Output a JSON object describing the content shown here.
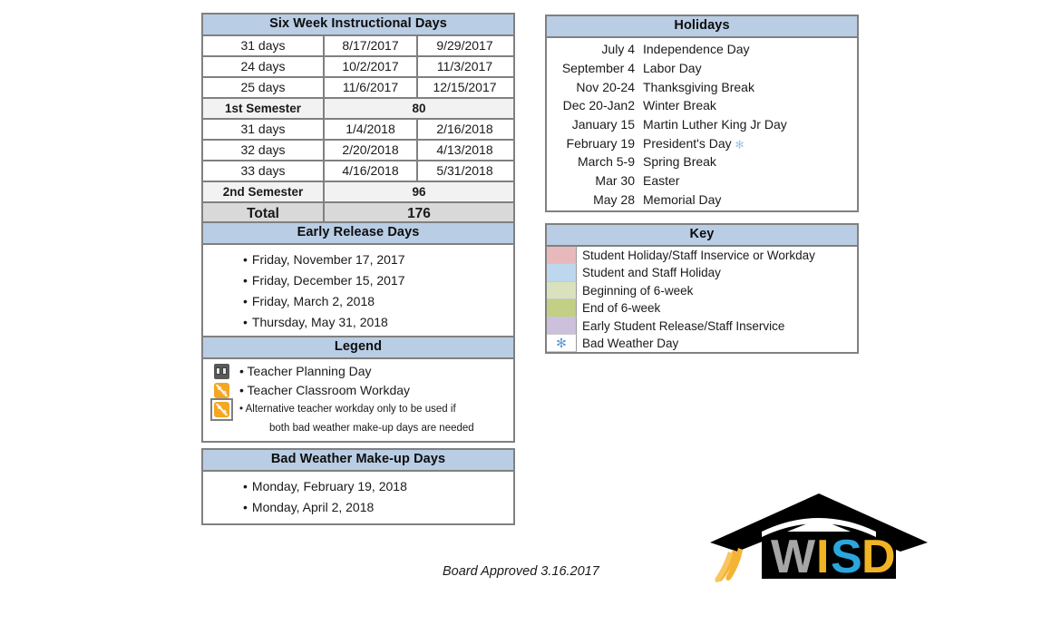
{
  "six_week": {
    "title": "Six Week Instructional Days",
    "rows": [
      {
        "type": "data",
        "days": "31 days",
        "start": "8/17/2017",
        "end": "9/29/2017"
      },
      {
        "type": "data",
        "days": "24 days",
        "start": "10/2/2017",
        "end": "11/3/2017"
      },
      {
        "type": "data",
        "days": "25 days",
        "start": "11/6/2017",
        "end": "12/15/2017"
      },
      {
        "type": "semester",
        "label": "1st Semester",
        "value": "80"
      },
      {
        "type": "data",
        "days": "31 days",
        "start": "1/4/2018",
        "end": "2/16/2018"
      },
      {
        "type": "data",
        "days": "32 days",
        "start": "2/20/2018",
        "end": "4/13/2018"
      },
      {
        "type": "data",
        "days": "33 days",
        "start": "4/16/2018",
        "end": "5/31/2018"
      },
      {
        "type": "semester",
        "label": "2nd Semester",
        "value": "96"
      },
      {
        "type": "total",
        "label": "Total",
        "value": "176"
      }
    ]
  },
  "holidays": {
    "title": "Holidays",
    "items": [
      {
        "date": "July 4",
        "name": "Independence Day",
        "snowflake": false
      },
      {
        "date": "September 4",
        "name": "Labor Day",
        "snowflake": false
      },
      {
        "date": "Nov 20-24",
        "name": "Thanksgiving Break",
        "snowflake": false
      },
      {
        "date": "Dec 20-Jan2",
        "name": "Winter Break",
        "snowflake": false
      },
      {
        "date": "January 15",
        "name": "Martin Luther King Jr Day",
        "snowflake": false
      },
      {
        "date": "February 19",
        "name": "President's Day",
        "snowflake": true
      },
      {
        "date": "March 5-9",
        "name": "Spring Break",
        "snowflake": false
      },
      {
        "date": "Mar 30",
        "name": "Easter",
        "snowflake": false
      },
      {
        "date": "May 28",
        "name": "Memorial Day",
        "snowflake": false
      }
    ]
  },
  "early_release": {
    "title": "Early Release Days",
    "items": [
      "Friday, November 17, 2017",
      "Friday, December 15, 2017",
      "Friday, March 2, 2018",
      "Thursday, May 31, 2018"
    ]
  },
  "key": {
    "title": "Key",
    "items": [
      {
        "color": "#e8b9bb",
        "label": "Student Holiday/Staff Inservice or Workday",
        "icon": ""
      },
      {
        "color": "#bdd7ee",
        "label": "Student and Staff Holiday",
        "icon": ""
      },
      {
        "color": "#d9e2bc",
        "label": "Beginning of 6-week",
        "icon": ""
      },
      {
        "color": "#c2cf84",
        "label": "End of 6-week",
        "icon": ""
      },
      {
        "color": "#cdc0dd",
        "label": "Early Student Release/Staff Inservice",
        "icon": ""
      },
      {
        "color": "#ffffff",
        "label": "Bad Weather Day",
        "icon": "snowflake-icon"
      }
    ]
  },
  "legend": {
    "title": "Legend",
    "items": [
      {
        "icon": "teacher-planning-day-icon",
        "text": "Teacher Planning Day",
        "boxed": false,
        "small": false
      },
      {
        "icon": "teacher-classroom-workday-icon",
        "text": "Teacher Classroom Workday",
        "boxed": false,
        "small": false
      },
      {
        "icon": "alternative-teacher-workday-icon",
        "text": "Alternative teacher workday only to be used if",
        "boxed": true,
        "small": true
      }
    ],
    "note": "both bad weather make-up days are needed"
  },
  "bad_weather": {
    "title": "Bad Weather Make-up Days",
    "items": [
      "Monday, February 19, 2018",
      "Monday, April 2, 2018"
    ]
  },
  "footer": {
    "board_approved": "Board Approved 3.16.2017"
  },
  "logo": {
    "letters": [
      {
        "char": "W",
        "color": "#a6a6a6"
      },
      {
        "char": "I",
        "color": "#f0b323"
      },
      {
        "char": "S",
        "color": "#2ba6dd"
      },
      {
        "char": "D",
        "color": "#f0b323"
      }
    ],
    "cap_color": "#000000",
    "tassel_color": "#f5b335",
    "alt_text": "WISD"
  },
  "symbols": {
    "bullet": "•",
    "snowflake": "✻"
  }
}
